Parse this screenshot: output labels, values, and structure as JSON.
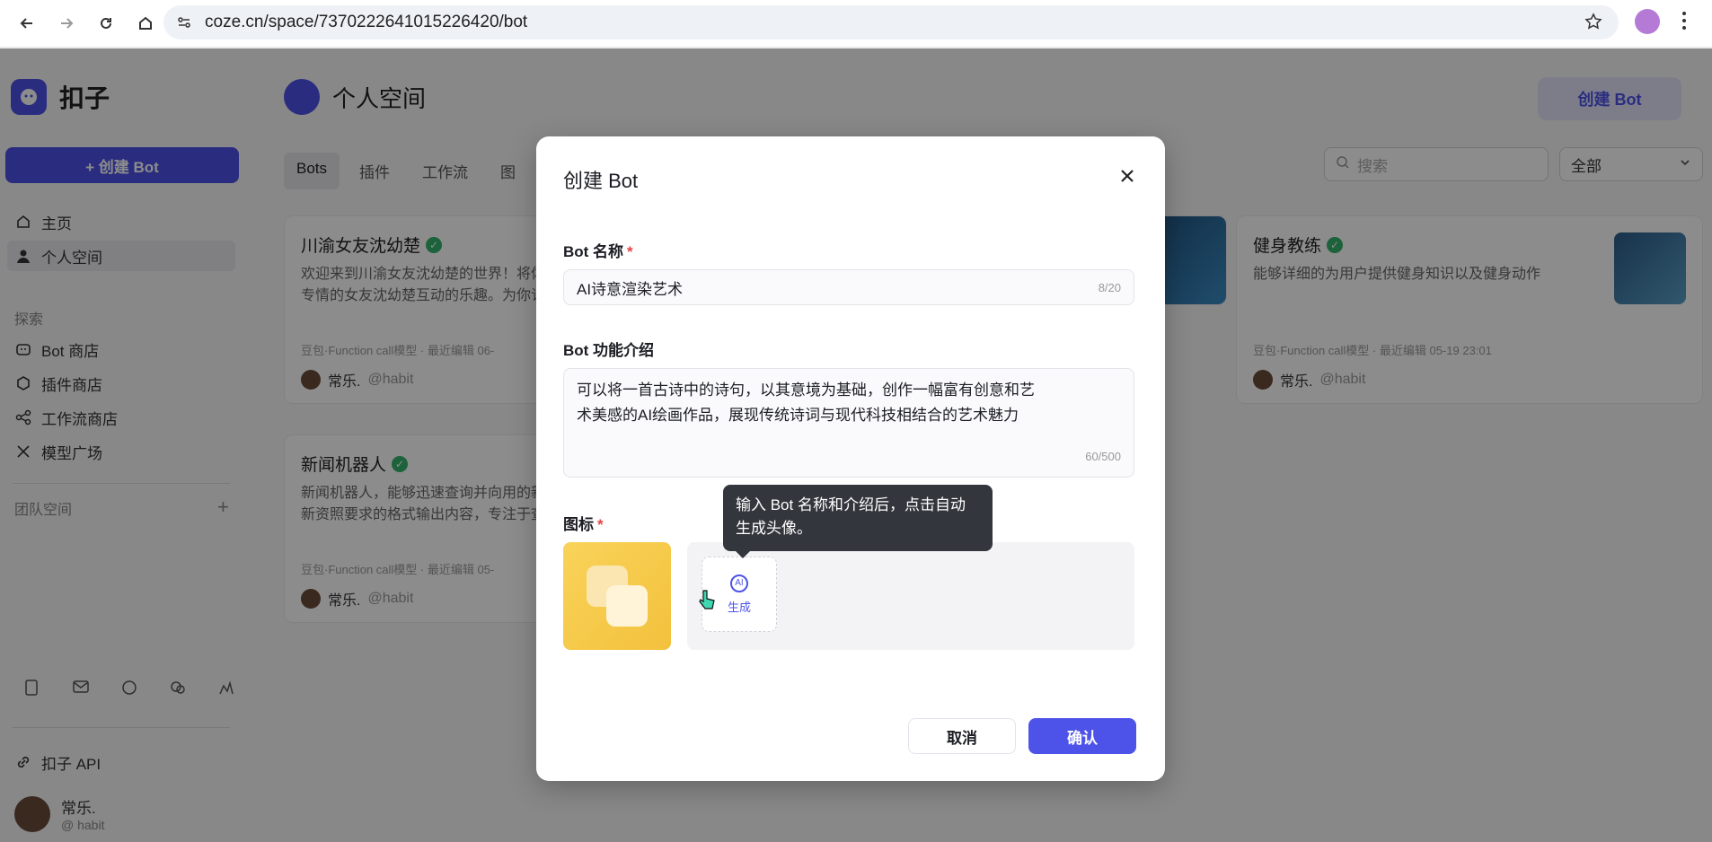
{
  "browser": {
    "url": "coze.cn/space/7370222641015226420/bot"
  },
  "sidebar": {
    "logo_text": "扣子",
    "create_bot": "+ 创建 Bot",
    "items": [
      {
        "label": "主页",
        "icon": "home-icon"
      },
      {
        "label": "个人空间",
        "icon": "user-icon"
      }
    ],
    "explore_section": "探索",
    "explore_items": [
      {
        "label": "Bot 商店",
        "icon": "bot-icon"
      },
      {
        "label": "插件商店",
        "icon": "cube-icon"
      },
      {
        "label": "工作流商店",
        "icon": "workflow-icon"
      },
      {
        "label": "模型广场",
        "icon": "model-icon"
      }
    ],
    "team_section": "团队空间",
    "api_label": "扣子 API",
    "user_name": "常乐.",
    "user_handle": "@ habit"
  },
  "main": {
    "page_title": "个人空间",
    "create_bot_top": "创建 Bot",
    "tabs": [
      "Bots",
      "插件",
      "工作流",
      "图"
    ],
    "search_placeholder": "搜索",
    "filter_value": "全部",
    "cards": [
      {
        "title": "川渝女友沈幼楚",
        "desc": "欢迎来到川渝女友沈幼楚的世界！将体验到与小说中那位纯真、专情的女友沈幼楚互动的乐趣。为你订",
        "meta": "豆包·Function call模型 · 最近编辑 06-",
        "owner": "常乐.",
        "handle": "@habit"
      },
      {
        "title": "健身教练",
        "desc": "能够详细的为用户提供健身知识以及健身动作",
        "meta": "豆包·Function call模型 · 最近编辑 05-19 23:01",
        "owner": "常乐.",
        "handle": "@habit"
      },
      {
        "title": "新闻机器人",
        "desc": "新闻机器人，能够迅速查询并向用的新闻信息，让你及时了解最新资照要求的格式输出内容，专注于查",
        "meta": "豆包·Function call模型 · 最近编辑 05-",
        "owner": "常乐.",
        "handle": "@habit"
      }
    ]
  },
  "modal": {
    "title": "创建 Bot",
    "name_label": "Bot 名称",
    "name_value": "AI诗意渲染艺术",
    "name_counter": "8/20",
    "desc_label": "Bot 功能介绍",
    "desc_line1": "可以将一首古诗中的诗句，以其意境为基础，创作一幅富有创意和艺",
    "desc_line2": "术美感的AI绘画作品，展现传统诗词与现代科技相结合的艺术魅力",
    "desc_counter": "60/500",
    "icon_label": "图标",
    "ai_badge": "AI",
    "ai_generate": "生成",
    "tooltip": "输入 Bot 名称和介绍后，点击自动生成头像。",
    "cancel": "取消",
    "confirm": "确认"
  }
}
